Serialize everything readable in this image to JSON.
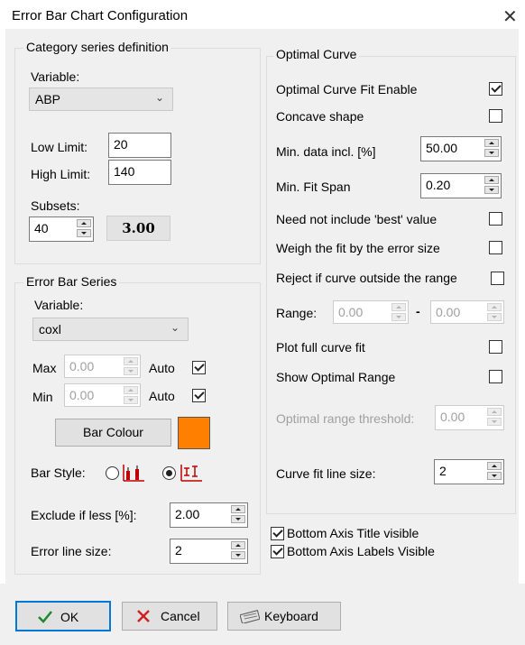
{
  "window": {
    "title": "Error Bar Chart Configuration",
    "close_glyph": "✕"
  },
  "category": {
    "group_label": "Category series definition",
    "variable_label": "Variable:",
    "variable_value": "ABP",
    "low_limit_label": "Low Limit:",
    "low_limit_value": "20",
    "high_limit_label": "High Limit:",
    "high_limit_value": "140",
    "subsets_label": "Subsets:",
    "subsets_value": "40",
    "subset_readout": "3.00"
  },
  "error_bar": {
    "group_label": "Error Bar Series",
    "variable_label": "Variable:",
    "variable_value": "coxl",
    "max_label": "Max",
    "max_value": "0.00",
    "max_auto_label": "Auto",
    "max_auto_checked": true,
    "min_label": "Min",
    "min_value": "0.00",
    "min_auto_label": "Auto",
    "min_auto_checked": true,
    "bar_colour_label": "Bar Colour",
    "bar_colour": "#ff8000",
    "bar_style_label": "Bar Style:",
    "bar_style_selected": "style-2",
    "exclude_label": "Exclude if less [%]:",
    "exclude_value": "2.00",
    "error_line_label": "Error line size:",
    "error_line_value": "2"
  },
  "optimal": {
    "group_label": "Optimal Curve",
    "fit_enable_label": "Optimal Curve Fit Enable",
    "fit_enable_checked": true,
    "concave_label": "Concave shape",
    "concave_checked": false,
    "min_data_label": "Min. data incl. [%]",
    "min_data_value": "50.00",
    "min_fit_span_label": "Min. Fit Span",
    "min_fit_span_value": "0.20",
    "need_not_label": "Need not include 'best' value",
    "need_not_checked": false,
    "weigh_label": "Weigh the fit by the error size",
    "weigh_checked": false,
    "reject_label": "Reject if curve outside the range",
    "reject_checked": false,
    "range_label": "Range:",
    "range_from": "0.00",
    "range_sep": "-",
    "range_to": "0.00",
    "plot_full_label": "Plot full curve fit",
    "plot_full_checked": false,
    "show_range_label": "Show Optimal Range",
    "show_range_checked": false,
    "threshold_label": "Optimal range threshold:",
    "threshold_value": "0.00",
    "curve_line_label": "Curve fit line size:",
    "curve_line_value": "2"
  },
  "axis": {
    "title_visible_label": "Bottom Axis Title visible",
    "title_visible_checked": true,
    "labels_visible_label": "Bottom Axis Labels Visible",
    "labels_visible_checked": true
  },
  "footer": {
    "ok_label": "OK",
    "cancel_label": "Cancel",
    "keyboard_label": "Keyboard"
  },
  "colors": {
    "ok_check": "#1a8a2e",
    "cancel_x": "#d02020",
    "bar_icon": "#c00000",
    "default_border": "#0078d7"
  }
}
